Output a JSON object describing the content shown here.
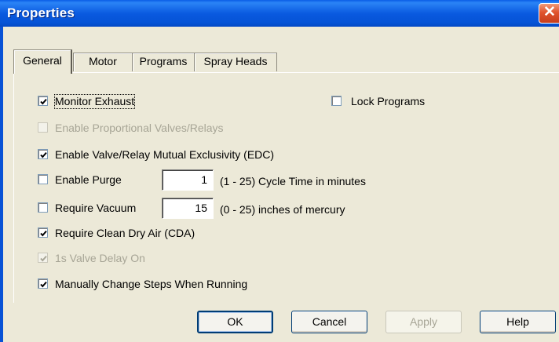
{
  "window": {
    "title": "Properties",
    "close_symbol": "✕"
  },
  "tabs": [
    {
      "label": "General",
      "active": true
    },
    {
      "label": "Motor",
      "active": false
    },
    {
      "label": "Programs",
      "active": false
    },
    {
      "label": "Spray Heads",
      "active": false
    }
  ],
  "general": {
    "monitor_exhaust": {
      "label": "Monitor Exhaust",
      "checked": true,
      "enabled": true
    },
    "lock_programs": {
      "label": "Lock Programs",
      "checked": false,
      "enabled": true
    },
    "enable_proportional": {
      "label": "Enable Proportional Valves/Relays",
      "checked": false,
      "enabled": false
    },
    "mutual_exclusivity": {
      "label": "Enable Valve/Relay Mutual Exclusivity (EDC)",
      "checked": true,
      "enabled": true
    },
    "enable_purge": {
      "label": "Enable Purge",
      "checked": false,
      "enabled": true,
      "value": "1",
      "unit": "(1 - 25) Cycle Time in minutes"
    },
    "require_vacuum": {
      "label": "Require Vacuum",
      "checked": false,
      "enabled": true,
      "value": "15",
      "unit": "(0 - 25) inches of mercury"
    },
    "require_cda": {
      "label": "Require Clean Dry Air (CDA)",
      "checked": true,
      "enabled": true
    },
    "valve_delay": {
      "label": "1s Valve Delay On",
      "checked": true,
      "enabled": false
    },
    "manual_steps": {
      "label": "Manually Change Steps When Running",
      "checked": true,
      "enabled": true
    }
  },
  "buttons": {
    "ok": "OK",
    "cancel": "Cancel",
    "apply": "Apply",
    "help": "Help"
  }
}
